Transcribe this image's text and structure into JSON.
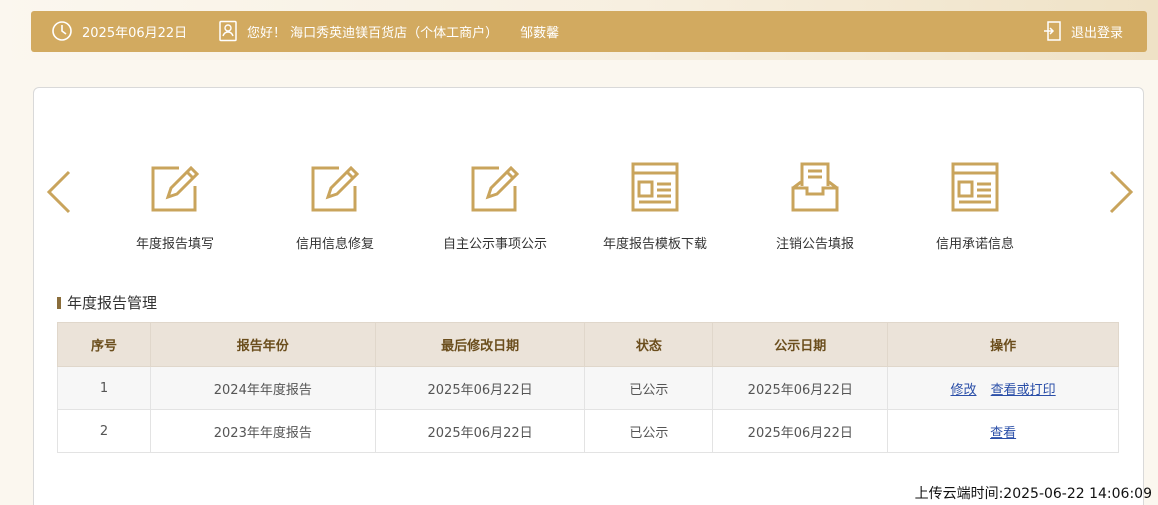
{
  "header": {
    "date": "2025年06月22日",
    "greeting": "您好！ 海口秀英迪镁百货店（个体工商户）",
    "user_name": "邹薮馨",
    "logout_label": "退出登录"
  },
  "functions": [
    {
      "label": "年度报告填写",
      "icon": "edit-icon"
    },
    {
      "label": "信用信息修复",
      "icon": "edit-icon"
    },
    {
      "label": "自主公示事项公示",
      "icon": "edit-icon"
    },
    {
      "label": "年度报告模板下载",
      "icon": "template-icon"
    },
    {
      "label": "注销公告填报",
      "icon": "inbox-icon"
    },
    {
      "label": "信用承诺信息",
      "icon": "template-icon"
    }
  ],
  "section": {
    "title": "年度报告管理"
  },
  "table": {
    "headers": [
      "序号",
      "报告年份",
      "最后修改日期",
      "状态",
      "公示日期",
      "操作"
    ],
    "rows": [
      {
        "no": "1",
        "year": "2024年年度报告",
        "modified": "2025年06月22日",
        "status": "已公示",
        "publish": "2025年06月22日",
        "action1": "修改",
        "action2": "查看或打印"
      },
      {
        "no": "2",
        "year": "2023年年度报告",
        "modified": "2025年06月22日",
        "status": "已公示",
        "publish": "2025年06月22日",
        "action1": "查看"
      }
    ]
  },
  "footer": {
    "upload_time": "上传云端时间:2025-06-22 14:06:09"
  },
  "colors": {
    "accent": "#d2aa60",
    "icon_gold": "#c9a45c",
    "link": "#2b4fa8"
  }
}
